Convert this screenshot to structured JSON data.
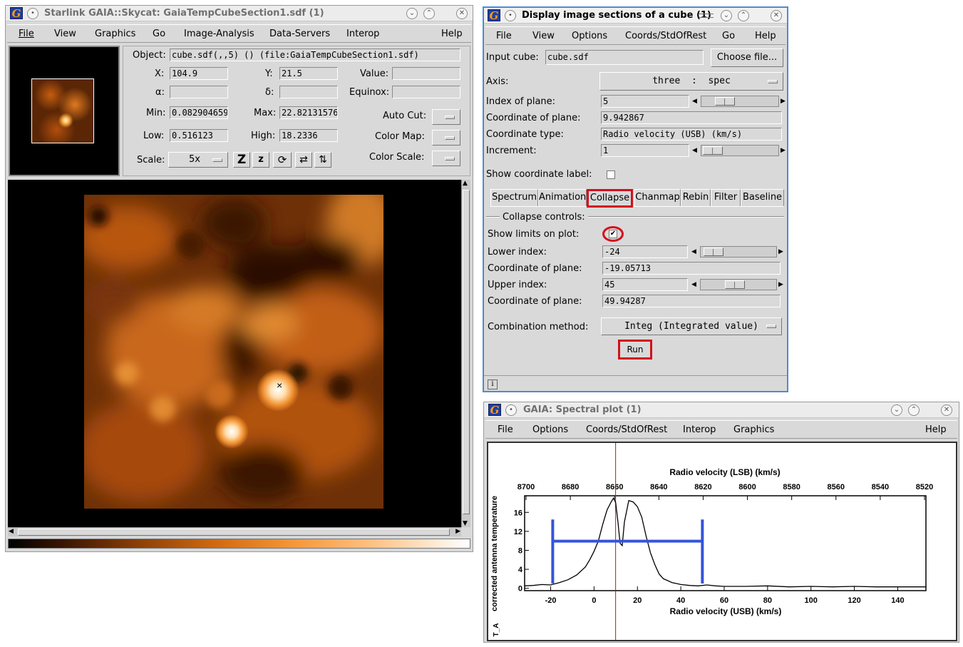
{
  "skycat": {
    "title": "Starlink GAIA::Skycat: GaiaTempCubeSection1.sdf (1)",
    "menu": [
      "File",
      "View",
      "Graphics",
      "Go",
      "Image-Analysis",
      "Data-Servers",
      "Interop",
      "Help"
    ],
    "object_label": "Object:",
    "object_value": "cube.sdf(,,5) () (file:GaiaTempCubeSection1.sdf)",
    "x_label": "X:",
    "x_value": "104.9",
    "y_label": "Y:",
    "y_value": "21.5",
    "value_label": "Value:",
    "value_value": "",
    "alpha_label": "α:",
    "alpha_value": "",
    "delta_label": "δ:",
    "delta_value": "",
    "equinox_label": "Equinox:",
    "equinox_value": "",
    "min_label": "Min:",
    "min_value": "0.082904659",
    "max_label": "Max:",
    "max_value": "22.82131576",
    "low_label": "Low:",
    "low_value": "0.516123",
    "high_label": "High:",
    "high_value": "18.2336",
    "autocut_label": "Auto Cut:",
    "colormap_label": "Color Map:",
    "colorscale_label": "Color Scale:",
    "scale_label": "Scale:",
    "scale_value": "5x",
    "cursor_mark": "×"
  },
  "cube": {
    "title": "Display image sections of a cube (1)",
    "menu": [
      "File",
      "View",
      "Options",
      "Coords/StdOfRest",
      "Go",
      "Help"
    ],
    "input_label": "Input cube:",
    "input_value": "cube.sdf",
    "choose_file": "Choose file...",
    "axis_label": "Axis:",
    "axis_value": "three  :  spec",
    "index_label": "Index of plane:",
    "index_value": "5",
    "coord_label": "Coordinate of plane:",
    "coord_value": "9.942867",
    "coord_type_label": "Coordinate type:",
    "coord_type_value": "Radio velocity (USB) (km/s)",
    "increment_label": "Increment:",
    "increment_value": "1",
    "show_coord_label": "Show coordinate label:",
    "tabs": [
      "Spectrum",
      "Animation",
      "Collapse",
      "Chanmap",
      "Rebin",
      "Filter",
      "Baseline"
    ],
    "active_tab": "Collapse",
    "collapse_title": "Collapse controls:",
    "show_limits_label": "Show limits on plot:",
    "show_limits_checked": true,
    "check_mark": "✔",
    "lower_index_label": "Lower index:",
    "lower_index_value": "-24",
    "lower_coord_label": "Coordinate of plane:",
    "lower_coord_value": "-19.05713",
    "upper_index_label": "Upper index:",
    "upper_index_value": "45",
    "upper_coord_label": "Coordinate of plane:",
    "upper_coord_value": "49.94287",
    "combination_label": "Combination method:",
    "combination_value": "Integ (Integrated value)",
    "run_label": "Run",
    "info_icon": "i"
  },
  "spectral": {
    "title": "GAIA: Spectral plot (1)",
    "menu": [
      "File",
      "Options",
      "Coords/StdOfRest",
      "Interop",
      "Graphics",
      "Help"
    ]
  },
  "chart_data": {
    "type": "line",
    "top_axis_label": "Radio velocity (LSB) (km/s)",
    "top_ticks": [
      "8700",
      "8680",
      "8660",
      "8640",
      "8620",
      "8600",
      "8580",
      "8560",
      "8540",
      "8520"
    ],
    "xlabel": "Radio velocity (USB) (km/s)",
    "ylabel": "corrected antenna temperature",
    "y_unit_label": "T_A",
    "x_ticks": [
      "-20",
      "0",
      "20",
      "40",
      "60",
      "80",
      "100",
      "120",
      "140"
    ],
    "y_ticks": [
      "0",
      "4",
      "8",
      "12",
      "16"
    ],
    "xlim": [
      -32,
      153
    ],
    "ylim": [
      -0.5,
      19.5
    ],
    "x": [
      -32,
      -28,
      -24,
      -20,
      -16,
      -12,
      -8,
      -4,
      -2,
      0,
      2,
      4,
      6,
      8,
      9,
      10,
      11,
      12,
      13,
      14,
      16,
      18,
      20,
      22,
      24,
      26,
      28,
      30,
      32,
      34,
      36,
      38,
      40,
      44,
      48,
      52,
      56,
      60,
      70,
      80,
      90,
      100,
      110,
      120,
      130,
      140,
      150,
      153
    ],
    "y": [
      0.5,
      0.6,
      0.8,
      0.7,
      1.2,
      1.8,
      2.8,
      4.5,
      6.0,
      7.8,
      10.0,
      13.5,
      16.5,
      18.3,
      19.0,
      18.0,
      14.0,
      9.5,
      9.0,
      14.0,
      18.5,
      18.2,
      17.2,
      15.0,
      11.0,
      7.5,
      5.0,
      3.0,
      2.0,
      1.6,
      1.2,
      1.0,
      0.8,
      0.6,
      0.5,
      0.7,
      0.5,
      0.4,
      0.4,
      0.5,
      0.3,
      0.4,
      0.3,
      0.4,
      0.3,
      0.3,
      0.3,
      0.3
    ],
    "limits": {
      "lower": -19.05713,
      "upper": 49.94287,
      "level": 9.94,
      "color": "#3554d8"
    },
    "current_plane": {
      "x": 9.942867,
      "color": "#c01010"
    }
  }
}
